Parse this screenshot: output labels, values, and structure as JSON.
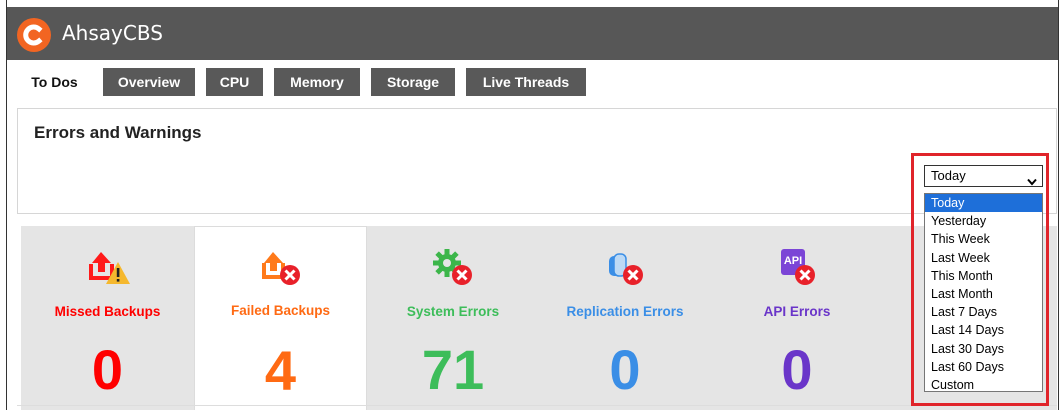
{
  "app": {
    "title": "AhsayCBS"
  },
  "tabs": [
    {
      "label": "To Dos",
      "active": true
    },
    {
      "label": "Overview",
      "active": false
    },
    {
      "label": "CPU",
      "active": false
    },
    {
      "label": "Memory",
      "active": false
    },
    {
      "label": "Storage",
      "active": false
    },
    {
      "label": "Live Threads",
      "active": false
    }
  ],
  "panel": {
    "title": "Errors and Warnings"
  },
  "range_select": {
    "value": "Today",
    "options": [
      "Today",
      "Yesterday",
      "This Week",
      "Last Week",
      "This Month",
      "Last Month",
      "Last 7 Days",
      "Last 14 Days",
      "Last 30 Days",
      "Last 60 Days",
      "Custom"
    ],
    "selected_index": 0
  },
  "cards": [
    {
      "label": "Missed Backups",
      "count": "0",
      "color": "#ff0000",
      "icon": "missed-backup-icon"
    },
    {
      "label": "Failed Backups",
      "count": "4",
      "color": "#ff6a13",
      "icon": "failed-backup-icon"
    },
    {
      "label": "System Errors",
      "count": "71",
      "color": "#3dbd5a",
      "icon": "system-error-gear-icon"
    },
    {
      "label": "Replication Errors",
      "count": "0",
      "color": "#3a8ee6",
      "icon": "replication-error-icon"
    },
    {
      "label": "API Errors",
      "count": "0",
      "color": "#6a35c9",
      "icon": "api-error-icon"
    }
  ],
  "colors": {
    "highlight": "#e0242a",
    "titlebar": "#575757",
    "brand": "#f26522"
  }
}
